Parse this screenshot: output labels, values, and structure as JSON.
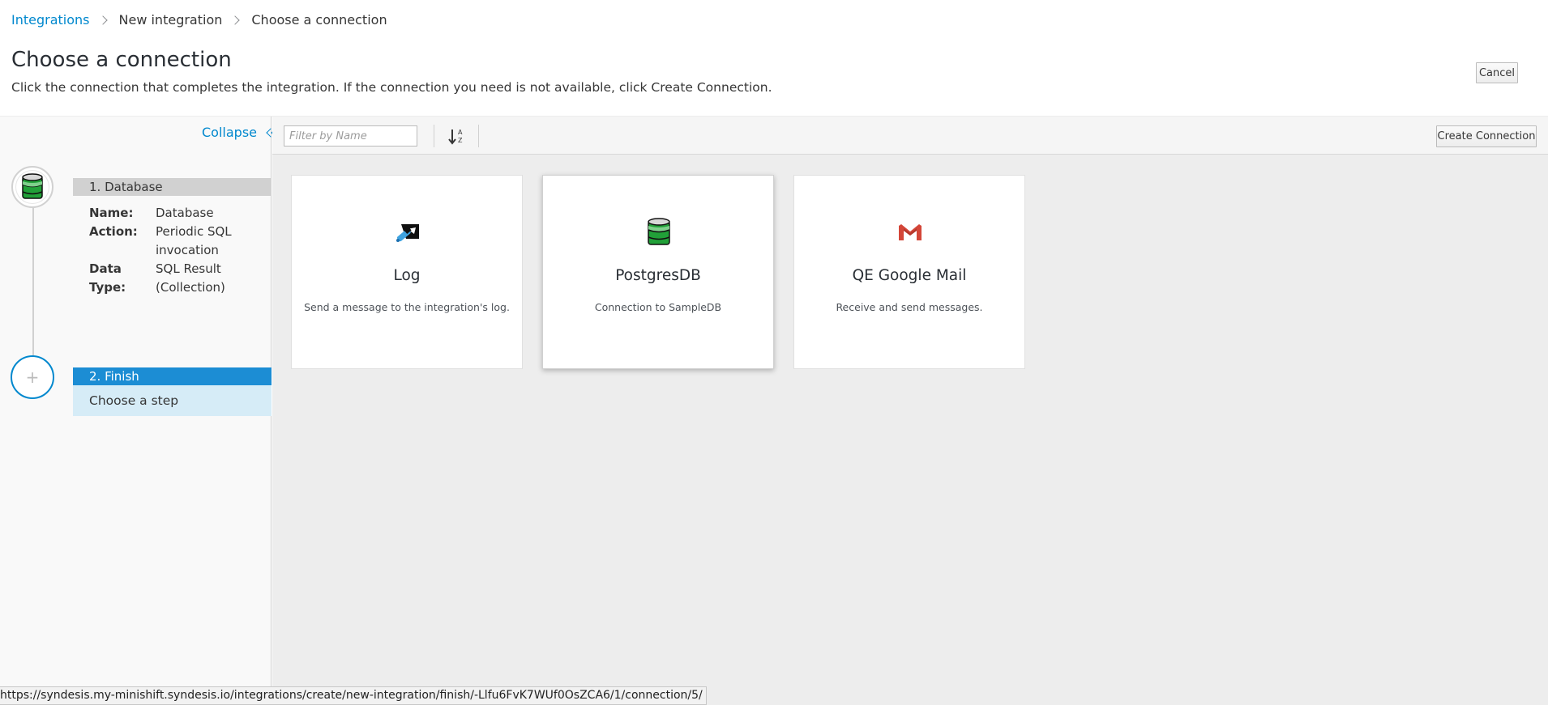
{
  "breadcrumb": {
    "items": [
      {
        "label": "Integrations",
        "link": true
      },
      {
        "label": "New integration",
        "link": false
      },
      {
        "label": "Choose a connection",
        "link": false
      }
    ]
  },
  "header": {
    "title": "Choose a connection",
    "description": "Click the connection that completes the integration. If the connection you need is not available, click Create Connection.",
    "cancel_label": "Cancel"
  },
  "flow": {
    "collapse_label": "Collapse",
    "steps": [
      {
        "header": "1. Database",
        "icon": "database-icon",
        "details": [
          {
            "key": "Name:",
            "value": "Database"
          },
          {
            "key": "Action:",
            "value": "Periodic SQL invocation"
          },
          {
            "key": "Data Type:",
            "value": "SQL Result (Collection)"
          }
        ]
      },
      {
        "header": "2. Finish",
        "icon": "plus-icon",
        "placeholder": "+",
        "subtitle": "Choose a step"
      }
    ]
  },
  "toolbar": {
    "filter_placeholder": "Filter by Name",
    "sort_icon": "sort-alpha-asc-icon",
    "create_label": "Create Connection"
  },
  "connections": [
    {
      "name": "Log",
      "description": "Send a message to the integration's log.",
      "icon": "log-icon"
    },
    {
      "name": "PostgresDB",
      "description": "Connection to SampleDB",
      "icon": "database-icon"
    },
    {
      "name": "QE Google Mail",
      "description": "Receive and send messages.",
      "icon": "gmail-icon"
    }
  ],
  "status_url": "https://syndesis.my-minishift.syndesis.io/integrations/create/new-integration/finish/-Llfu6FvK7WUf0OsZCA6/1/connection/5/",
  "colors": {
    "link": "#0088ce",
    "active_step": "#1c8dd4",
    "active_step_sub": "#d6ecf7",
    "db_green": "#21a038",
    "gmail_red": "#d44638"
  }
}
